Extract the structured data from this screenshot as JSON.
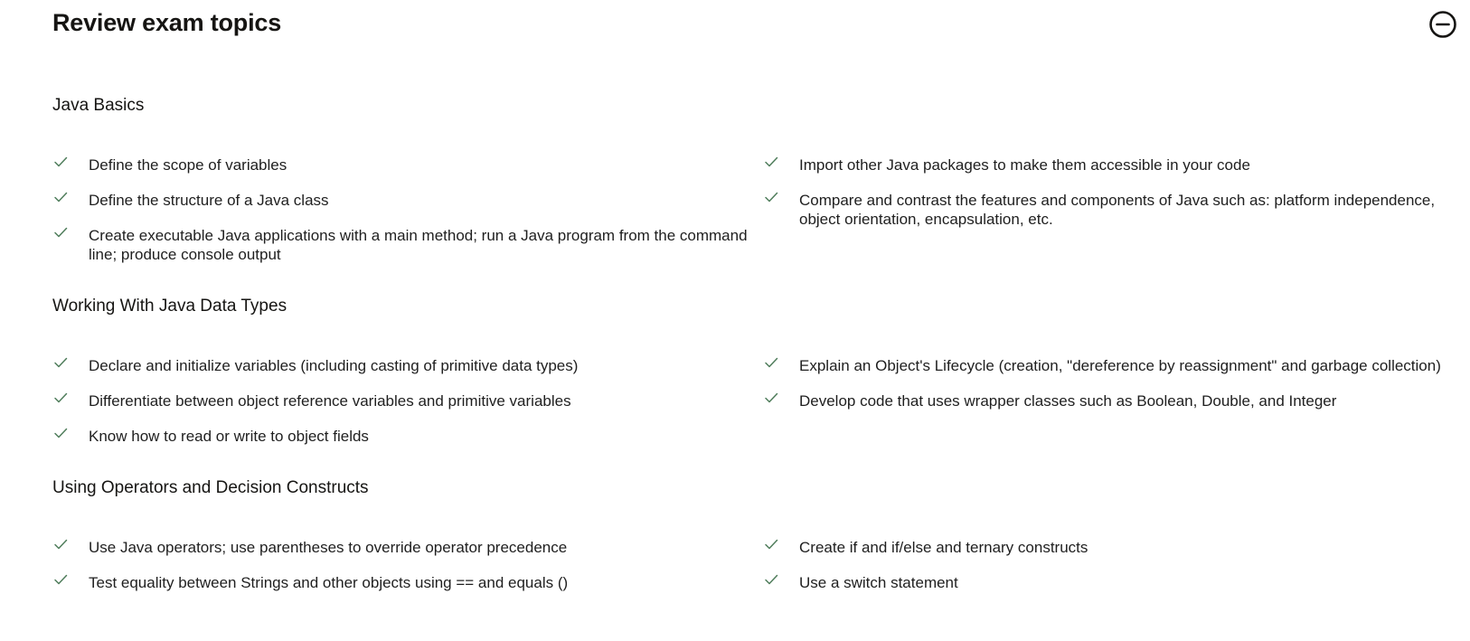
{
  "page": {
    "title": "Review exam topics",
    "collapse_icon": "minus-circle-icon",
    "check_icon": "checkmark-icon",
    "check_color": "#4f7d5b"
  },
  "sections": [
    {
      "title": "Java Basics",
      "left": [
        "Define the scope of variables",
        "Define the structure of a Java class",
        "Create executable Java applications with a main method; run a Java program from the command line; produce console output"
      ],
      "right": [
        "Import other Java packages to make them accessible in your code",
        "Compare and contrast the features and components of Java such as: platform independence, object orientation, encapsulation, etc."
      ]
    },
    {
      "title": "Working With Java Data Types",
      "left": [
        "Declare and initialize variables (including casting of primitive data types)",
        "Differentiate between object reference variables and primitive variables",
        "Know how to read or write to object fields"
      ],
      "right": [
        "Explain an Object's Lifecycle (creation, \"dereference by reassignment\" and garbage collection)",
        "Develop code that uses wrapper classes such as Boolean, Double, and Integer"
      ]
    },
    {
      "title": "Using Operators and Decision Constructs",
      "left": [
        "Use Java operators; use parentheses to override operator precedence",
        "Test equality between Strings and other objects using == and equals ()"
      ],
      "right": [
        "Create if and if/else and ternary constructs",
        "Use a switch statement"
      ]
    }
  ]
}
